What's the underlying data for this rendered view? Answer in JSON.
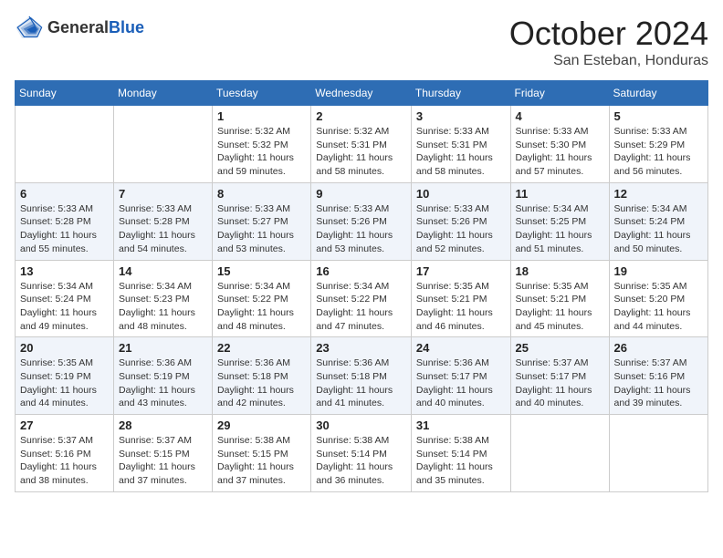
{
  "header": {
    "logo_general": "General",
    "logo_blue": "Blue",
    "month_title": "October 2024",
    "location": "San Esteban, Honduras"
  },
  "weekdays": [
    "Sunday",
    "Monday",
    "Tuesday",
    "Wednesday",
    "Thursday",
    "Friday",
    "Saturday"
  ],
  "weeks": [
    [
      {
        "day": "",
        "sunrise": "",
        "sunset": "",
        "daylight": ""
      },
      {
        "day": "",
        "sunrise": "",
        "sunset": "",
        "daylight": ""
      },
      {
        "day": "1",
        "sunrise": "Sunrise: 5:32 AM",
        "sunset": "Sunset: 5:32 PM",
        "daylight": "Daylight: 11 hours and 59 minutes."
      },
      {
        "day": "2",
        "sunrise": "Sunrise: 5:32 AM",
        "sunset": "Sunset: 5:31 PM",
        "daylight": "Daylight: 11 hours and 58 minutes."
      },
      {
        "day": "3",
        "sunrise": "Sunrise: 5:33 AM",
        "sunset": "Sunset: 5:31 PM",
        "daylight": "Daylight: 11 hours and 58 minutes."
      },
      {
        "day": "4",
        "sunrise": "Sunrise: 5:33 AM",
        "sunset": "Sunset: 5:30 PM",
        "daylight": "Daylight: 11 hours and 57 minutes."
      },
      {
        "day": "5",
        "sunrise": "Sunrise: 5:33 AM",
        "sunset": "Sunset: 5:29 PM",
        "daylight": "Daylight: 11 hours and 56 minutes."
      }
    ],
    [
      {
        "day": "6",
        "sunrise": "Sunrise: 5:33 AM",
        "sunset": "Sunset: 5:28 PM",
        "daylight": "Daylight: 11 hours and 55 minutes."
      },
      {
        "day": "7",
        "sunrise": "Sunrise: 5:33 AM",
        "sunset": "Sunset: 5:28 PM",
        "daylight": "Daylight: 11 hours and 54 minutes."
      },
      {
        "day": "8",
        "sunrise": "Sunrise: 5:33 AM",
        "sunset": "Sunset: 5:27 PM",
        "daylight": "Daylight: 11 hours and 53 minutes."
      },
      {
        "day": "9",
        "sunrise": "Sunrise: 5:33 AM",
        "sunset": "Sunset: 5:26 PM",
        "daylight": "Daylight: 11 hours and 53 minutes."
      },
      {
        "day": "10",
        "sunrise": "Sunrise: 5:33 AM",
        "sunset": "Sunset: 5:26 PM",
        "daylight": "Daylight: 11 hours and 52 minutes."
      },
      {
        "day": "11",
        "sunrise": "Sunrise: 5:34 AM",
        "sunset": "Sunset: 5:25 PM",
        "daylight": "Daylight: 11 hours and 51 minutes."
      },
      {
        "day": "12",
        "sunrise": "Sunrise: 5:34 AM",
        "sunset": "Sunset: 5:24 PM",
        "daylight": "Daylight: 11 hours and 50 minutes."
      }
    ],
    [
      {
        "day": "13",
        "sunrise": "Sunrise: 5:34 AM",
        "sunset": "Sunset: 5:24 PM",
        "daylight": "Daylight: 11 hours and 49 minutes."
      },
      {
        "day": "14",
        "sunrise": "Sunrise: 5:34 AM",
        "sunset": "Sunset: 5:23 PM",
        "daylight": "Daylight: 11 hours and 48 minutes."
      },
      {
        "day": "15",
        "sunrise": "Sunrise: 5:34 AM",
        "sunset": "Sunset: 5:22 PM",
        "daylight": "Daylight: 11 hours and 48 minutes."
      },
      {
        "day": "16",
        "sunrise": "Sunrise: 5:34 AM",
        "sunset": "Sunset: 5:22 PM",
        "daylight": "Daylight: 11 hours and 47 minutes."
      },
      {
        "day": "17",
        "sunrise": "Sunrise: 5:35 AM",
        "sunset": "Sunset: 5:21 PM",
        "daylight": "Daylight: 11 hours and 46 minutes."
      },
      {
        "day": "18",
        "sunrise": "Sunrise: 5:35 AM",
        "sunset": "Sunset: 5:21 PM",
        "daylight": "Daylight: 11 hours and 45 minutes."
      },
      {
        "day": "19",
        "sunrise": "Sunrise: 5:35 AM",
        "sunset": "Sunset: 5:20 PM",
        "daylight": "Daylight: 11 hours and 44 minutes."
      }
    ],
    [
      {
        "day": "20",
        "sunrise": "Sunrise: 5:35 AM",
        "sunset": "Sunset: 5:19 PM",
        "daylight": "Daylight: 11 hours and 44 minutes."
      },
      {
        "day": "21",
        "sunrise": "Sunrise: 5:36 AM",
        "sunset": "Sunset: 5:19 PM",
        "daylight": "Daylight: 11 hours and 43 minutes."
      },
      {
        "day": "22",
        "sunrise": "Sunrise: 5:36 AM",
        "sunset": "Sunset: 5:18 PM",
        "daylight": "Daylight: 11 hours and 42 minutes."
      },
      {
        "day": "23",
        "sunrise": "Sunrise: 5:36 AM",
        "sunset": "Sunset: 5:18 PM",
        "daylight": "Daylight: 11 hours and 41 minutes."
      },
      {
        "day": "24",
        "sunrise": "Sunrise: 5:36 AM",
        "sunset": "Sunset: 5:17 PM",
        "daylight": "Daylight: 11 hours and 40 minutes."
      },
      {
        "day": "25",
        "sunrise": "Sunrise: 5:37 AM",
        "sunset": "Sunset: 5:17 PM",
        "daylight": "Daylight: 11 hours and 40 minutes."
      },
      {
        "day": "26",
        "sunrise": "Sunrise: 5:37 AM",
        "sunset": "Sunset: 5:16 PM",
        "daylight": "Daylight: 11 hours and 39 minutes."
      }
    ],
    [
      {
        "day": "27",
        "sunrise": "Sunrise: 5:37 AM",
        "sunset": "Sunset: 5:16 PM",
        "daylight": "Daylight: 11 hours and 38 minutes."
      },
      {
        "day": "28",
        "sunrise": "Sunrise: 5:37 AM",
        "sunset": "Sunset: 5:15 PM",
        "daylight": "Daylight: 11 hours and 37 minutes."
      },
      {
        "day": "29",
        "sunrise": "Sunrise: 5:38 AM",
        "sunset": "Sunset: 5:15 PM",
        "daylight": "Daylight: 11 hours and 37 minutes."
      },
      {
        "day": "30",
        "sunrise": "Sunrise: 5:38 AM",
        "sunset": "Sunset: 5:14 PM",
        "daylight": "Daylight: 11 hours and 36 minutes."
      },
      {
        "day": "31",
        "sunrise": "Sunrise: 5:38 AM",
        "sunset": "Sunset: 5:14 PM",
        "daylight": "Daylight: 11 hours and 35 minutes."
      },
      {
        "day": "",
        "sunrise": "",
        "sunset": "",
        "daylight": ""
      },
      {
        "day": "",
        "sunrise": "",
        "sunset": "",
        "daylight": ""
      }
    ]
  ]
}
